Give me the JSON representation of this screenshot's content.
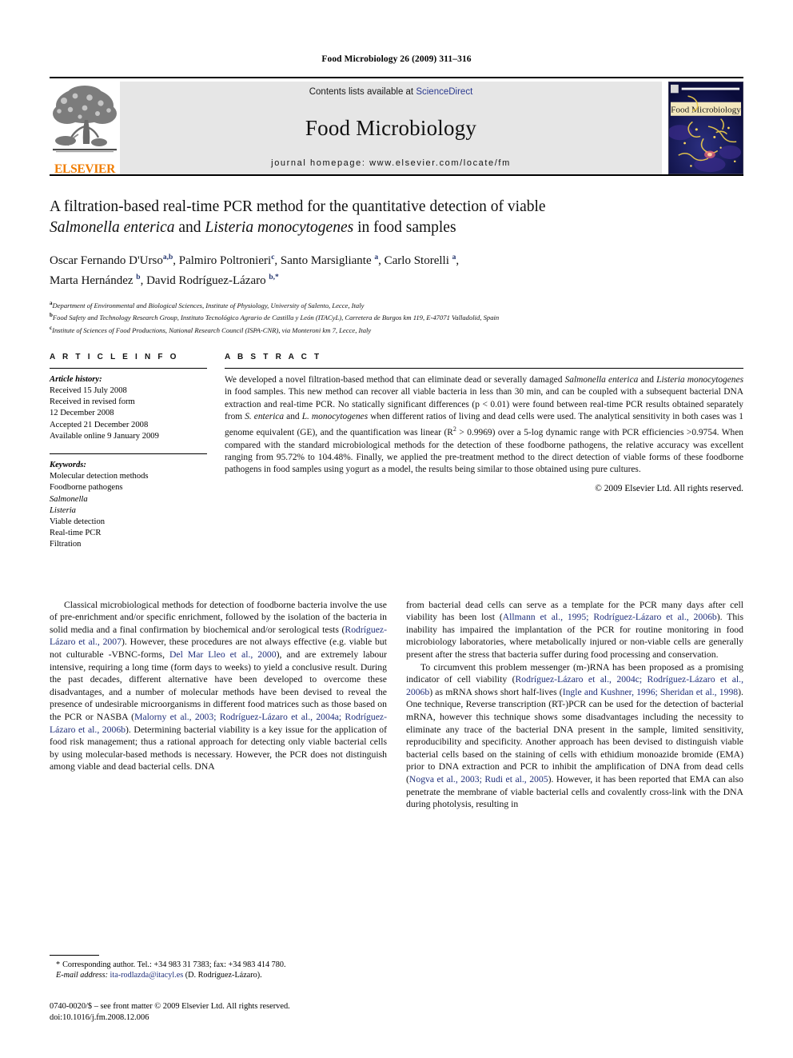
{
  "running_head": "Food Microbiology 26 (2009) 311–316",
  "header": {
    "contents_prefix": "Contents lists available at ",
    "sciencedirect": "ScienceDirect",
    "journal_title": "Food Microbiology",
    "homepage": "journal homepage: www.elsevier.com/locate/fm",
    "publisher_name": "ELSEVIER",
    "cover_caption": "Food Microbiology",
    "accent_link_color": "#2b3a8f",
    "publisher_color": "#F07D00",
    "band_color": "#e6e6e6"
  },
  "article": {
    "title_line1": "A filtration-based real-time PCR method for the quantitative detection of viable",
    "title_italic_1": "Salmonella enterica",
    "title_mid": " and ",
    "title_italic_2": "Listeria monocytogenes",
    "title_tail": " in food samples",
    "authors_line1": "Oscar Fernando D'Urso",
    "authors_sup1": "a,b",
    "authors_2": ", Palmiro Poltronieri",
    "authors_sup2": "c",
    "authors_3": ", Santo Marsigliante ",
    "authors_sup3": "a",
    "authors_4": ", Carlo Storelli ",
    "authors_sup4": "a",
    "authors_5": ",",
    "authors_line2a": "Marta Hernández ",
    "authors_sup5": "b",
    "authors_line2b": ", David Rodríguez-Lázaro ",
    "authors_sup6": "b,*",
    "affiliations": [
      {
        "marker": "a",
        "text": "Department of Environmental and Biological Sciences, Institute of Physiology, University of Salento, Lecce, Italy"
      },
      {
        "marker": "b",
        "text": "Food Safety and Technology Research Group, Instituto Tecnológico Agrario de Castilla y León (ITACyL), Carretera de Burgos km 119, E-47071 Valladolid, Spain"
      },
      {
        "marker": "c",
        "text": "Institute of Sciences of Food Productions, National Research Council (ISPA-CNR), via Monteroni km 7, Lecce, Italy"
      }
    ]
  },
  "article_info": {
    "heading": "A R T I C L E  I N F O",
    "history_label": "Article history:",
    "history_lines": [
      "Received 15 July 2008",
      "Received in revised form",
      "12 December 2008",
      "Accepted 21 December 2008",
      "Available online 9 January 2009"
    ],
    "keywords_label": "Keywords:",
    "keywords": [
      "Molecular detection methods",
      "Foodborne pathogens",
      "Salmonella",
      "Listeria",
      "Viable detection",
      "Real-time PCR",
      "Filtration"
    ],
    "keywords_italic_flags": [
      false,
      false,
      true,
      true,
      false,
      false,
      false
    ]
  },
  "abstract": {
    "heading": "A B S T R A C T",
    "paragraph_html": "We developed a novel filtration-based method that can eliminate dead or severally damaged <i>Salmonella enterica</i> and <i>Listeria monocytogenes</i> in food samples. This new method can recover all viable bacteria in less than 30 min, and can be coupled with a subsequent bacterial DNA extraction and real-time PCR. No statically significant differences (p&nbsp;&lt;&nbsp;0.01) were found between real-time PCR results obtained separately from <i>S. enterica</i> and <i>L. monocytogenes</i> when different ratios of living and dead cells were used. The analytical sensitivity in both cases was 1 genome equivalent (GE), and the quantification was linear (R<sup>2</sup>&nbsp;&gt;&nbsp;0.9969) over a 5-log dynamic range with PCR efficiencies &gt;0.9754. When compared with the standard microbiological methods for the detection of these foodborne pathogens, the relative accuracy was excellent ranging from 95.72% to 104.48%. Finally, we applied the pre-treatment method to the direct detection of viable forms of these foodborne pathogens in food samples using yogurt as a model, the results being similar to those obtained using pure cultures.",
    "copyright": "© 2009 Elsevier Ltd. All rights reserved."
  },
  "body": {
    "left_paragraphs_html": [
      "Classical microbiological methods for detection of foodborne bacteria involve the use of pre-enrichment and/or specific enrichment, followed by the isolation of the bacteria in solid media and a final confirmation by biochemical and/or serological tests (<span class=\"ref\">Rodríguez-Lázaro et al., 2007</span>). However, these procedures are not always effective (e.g. viable but not culturable -VBNC-forms, <span class=\"ref\">Del Mar Lleo et al., 2000</span>), and are extremely labour intensive, requiring a long time (form days to weeks) to yield a conclusive result. During the past decades, different alternative have been developed to overcome these disadvantages, and a number of molecular methods have been devised to reveal the presence of undesirable microorganisms in different food matrices such as those based on the PCR or NASBA (<span class=\"ref\">Malorny et al., 2003; Rodríguez-Lázaro et al., 2004a; Rodríguez-Lázaro et al., 2006b</span>). Determining bacterial viability is a key issue for the application of food risk management; thus a rational approach for detecting only viable bacterial cells by using molecular-based methods is necessary. However, the PCR does not distinguish among viable and dead bacterial cells. DNA"
    ],
    "right_paragraphs_html": [
      "from bacterial dead cells can serve as a template for the PCR many days after cell viability has been lost (<span class=\"ref\">Allmann et al., 1995; Rodríguez-Lázaro et al., 2006b</span>). This inability has impaired the implantation of the PCR for routine monitoring in food microbiology laboratories, where metabolically injured or non-viable cells are generally present after the stress that bacteria suffer during food processing and conservation.",
      "To circumvent this problem messenger (m-)RNA has been proposed as a promising indicator of cell viability (<span class=\"ref\">Rodríguez-Lázaro et al., 2004c; Rodríguez-Lázaro et al., 2006b</span>) as mRNA shows short half-lives (<span class=\"ref\">Ingle and Kushner, 1996; Sheridan et al., 1998</span>). One technique, Reverse transcription (RT-)PCR can be used for the detection of bacterial mRNA, however this technique shows some disadvantages including the necessity to eliminate any trace of the bacterial DNA present in the sample, limited sensitivity, reproducibility and specificity. Another approach has been devised to distinguish viable bacterial cells based on the staining of cells with ethidium monoazide bromide (EMA) prior to DNA extraction and PCR to inhibit the amplification of DNA from dead cells (<span class=\"ref\">Nogva et al., 2003; Rudi et al., 2005</span>). However, it has been reported that EMA can also penetrate the membrane of viable bacterial cells and covalently cross-link with the DNA during photolysis, resulting in"
    ]
  },
  "footnote": {
    "corr_marker": "*",
    "corr_text": "Corresponding author. Tel.: +34 983 31 7383; fax: +34 983 414 780.",
    "email_label": "E-mail address:",
    "email": "ita-rodlazda@itacyl.es",
    "email_owner": "(D. Rodríguez-Lázaro)."
  },
  "footer": {
    "issn_line": "0740-0020/$ – see front matter © 2009 Elsevier Ltd. All rights reserved.",
    "doi_line": "doi:10.1016/j.fm.2008.12.006"
  }
}
